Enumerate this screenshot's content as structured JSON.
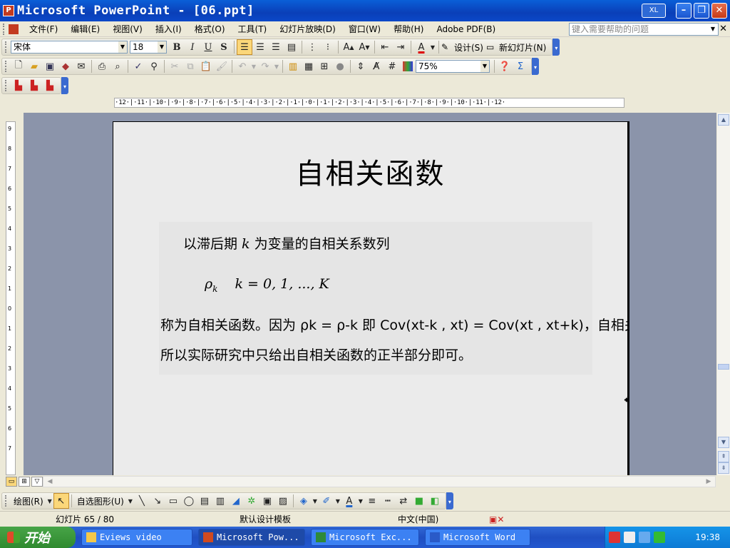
{
  "window": {
    "title": "Microsoft PowerPoint - [06.ppt]",
    "badge": "XL"
  },
  "menu": {
    "items": [
      "文件(F)",
      "编辑(E)",
      "视图(V)",
      "插入(I)",
      "格式(O)",
      "工具(T)",
      "幻灯片放映(D)",
      "窗口(W)",
      "帮助(H)",
      "Adobe PDF(B)"
    ],
    "help_placeholder": "键入需要帮助的问题"
  },
  "format_toolbar": {
    "font": "宋体",
    "size": "18",
    "bold": "B",
    "italic": "I",
    "underline": "U",
    "shadow": "S",
    "design_label": "设计(S)",
    "new_slide_label": "新幻灯片(N)"
  },
  "standard_toolbar": {
    "zoom": "75%"
  },
  "ruler": {
    "horizontal": "·12·|·11·|·10·|·9·|·8·|·7·|·6·|·5·|·4·|·3·|·2·|·1·|·0·|·1·|·2·|·3·|·4·|·5·|·6·|·7·|·8·|·9·|·10·|·11·|·12·",
    "vertical_ticks": [
      "9",
      "8",
      "7",
      "6",
      "5",
      "4",
      "3",
      "2",
      "1",
      "0",
      "1",
      "2",
      "3",
      "4",
      "5",
      "6",
      "7"
    ]
  },
  "slide": {
    "title": "自相关函数",
    "line1_prefix": "以滞后期 ",
    "line1_var": "k",
    "line1_suffix": " 为变量的自相关系数列",
    "eq_lhs": "ρ",
    "eq_sub": "k",
    "eq_rhs": "k = 0, 1, ..., K",
    "line3": "称为自相关函数。因为 ρk = ρ-k 即 Cov(xt-k , xt) = Cov(xt , xt+k)，自相关函数是零对称的，",
    "line4": "所以实际研究中只给出自相关函数的正半部分即可。"
  },
  "draw_toolbar": {
    "draw_label": "绘图(R)",
    "autoshape_label": "自选图形(U)"
  },
  "status": {
    "slide_info": "幻灯片 65 / 80",
    "template": "默认设计模板",
    "language": "中文(中国)"
  },
  "taskbar": {
    "start": "开始",
    "tasks": [
      "Eviews video",
      "Microsoft Pow...",
      "Microsoft Exc...",
      "Microsoft Word"
    ],
    "clock": "19:38"
  }
}
